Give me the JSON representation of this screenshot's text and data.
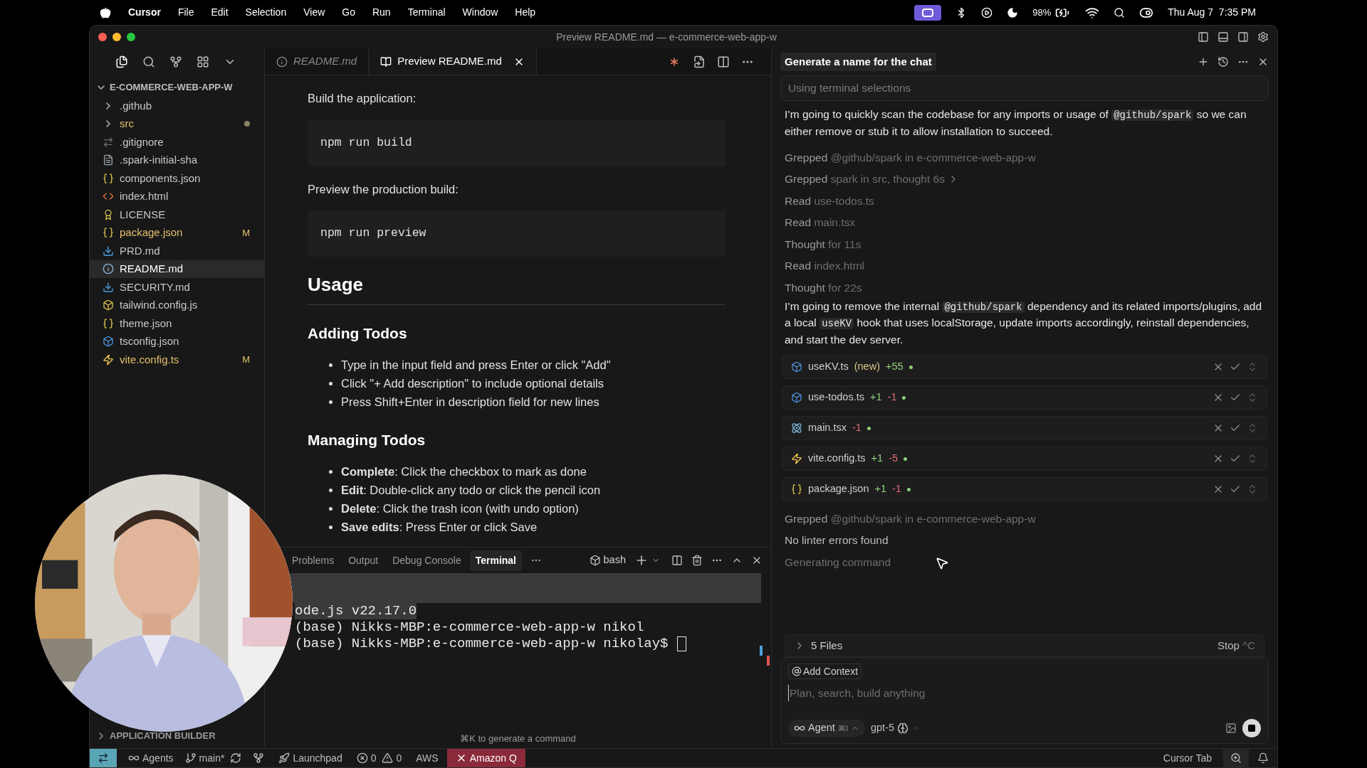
{
  "menubar": {
    "app": "Cursor",
    "items": [
      "File",
      "Edit",
      "Selection",
      "View",
      "Go",
      "Run",
      "Terminal",
      "Window",
      "Help"
    ],
    "battery": "98%",
    "clock": "Thu Aug 7  7:35 PM"
  },
  "window": {
    "title": "Preview README.md — e-commerce-web-app-w"
  },
  "explorer": {
    "root": "E-COMMERCE-WEB-APP-W",
    "expanded": true,
    "items": [
      {
        "name": ".github",
        "kind": "folder",
        "modified": false,
        "selected": false
      },
      {
        "name": "src",
        "kind": "folder",
        "modified": true,
        "dot": true,
        "selected": false
      },
      {
        "name": ".gitignore",
        "kind": "git",
        "modified": false,
        "selected": false
      },
      {
        "name": ".spark-initial-sha",
        "kind": "text",
        "modified": false,
        "selected": false
      },
      {
        "name": "components.json",
        "kind": "json",
        "modified": false,
        "selected": false
      },
      {
        "name": "index.html",
        "kind": "html",
        "modified": false,
        "selected": false
      },
      {
        "name": "LICENSE",
        "kind": "license",
        "modified": false,
        "selected": false
      },
      {
        "name": "package.json",
        "kind": "json",
        "modified": true,
        "badge": "M",
        "selected": false
      },
      {
        "name": "PRD.md",
        "kind": "md",
        "modified": false,
        "selected": false
      },
      {
        "name": "README.md",
        "kind": "info",
        "modified": false,
        "selected": true
      },
      {
        "name": "SECURITY.md",
        "kind": "md",
        "modified": false,
        "selected": false
      },
      {
        "name": "tailwind.config.js",
        "kind": "js",
        "modified": false,
        "selected": false
      },
      {
        "name": "theme.json",
        "kind": "json",
        "modified": false,
        "selected": false
      },
      {
        "name": "tsconfig.json",
        "kind": "ts",
        "modified": false,
        "selected": false
      },
      {
        "name": "vite.config.ts",
        "kind": "vite",
        "modified": true,
        "badge": "M",
        "selected": false
      }
    ],
    "sections": [
      "APPLICATION BUILDER"
    ]
  },
  "editor": {
    "tabs": [
      {
        "label": "README.md",
        "selected": false,
        "italic": true
      },
      {
        "label": "Preview README.md",
        "selected": true,
        "italic": false
      }
    ],
    "blocks": [
      {
        "kind": "p",
        "text": "Build the application:"
      },
      {
        "kind": "code",
        "text": "npm run build"
      },
      {
        "kind": "p",
        "text": "Preview the production build:"
      },
      {
        "kind": "code",
        "text": "npm run preview"
      },
      {
        "kind": "h1",
        "text": "Usage"
      },
      {
        "kind": "h2",
        "text": "Adding Todos"
      },
      {
        "kind": "list",
        "items": [
          "Type in the input field and press Enter or click \"Add\"",
          "Click \"+ Add description\" to include optional details",
          "Press Shift+Enter in description field for new lines"
        ]
      },
      {
        "kind": "h2",
        "text": "Managing Todos"
      },
      {
        "kind": "list",
        "items": [
          "**Complete**: Click the checkbox to mark as done",
          "**Edit**: Double-click any todo or click the pencil icon",
          "**Delete**: Click the trash icon (with undo option)",
          "**Save edits**: Press Enter or click Save"
        ]
      }
    ]
  },
  "terminal": {
    "tabs": [
      {
        "label": "Problems",
        "selected": false
      },
      {
        "label": "Output",
        "selected": false
      },
      {
        "label": "Debug Console",
        "selected": false
      },
      {
        "label": "Terminal",
        "selected": true
      }
    ],
    "shell": "bash",
    "lines": [
      "ode.js v22.17.0",
      "(base) Nikks-MBP:e-commerce-web-app-w nikol",
      "(base) Nikks-MBP:e-commerce-web-app-w nikolay$"
    ],
    "hint": "⌘K to generate a command"
  },
  "chat": {
    "title": "Generate a name for the chat",
    "context": "Using terminal selections",
    "entries": [
      {
        "kind": "message",
        "parts": [
          {
            "text": "I’m going to quickly scan the codebase for any imports or usage of ",
            "code": false
          },
          {
            "text": "@github/spark",
            "code": true
          },
          {
            "text": " so we can either remove or stub it to allow installation to succeed.",
            "code": false
          }
        ]
      },
      {
        "kind": "step",
        "verb": "Grepped",
        "detail": "@github/spark in e-commerce-web-app-w",
        "expandable": false
      },
      {
        "kind": "step",
        "verb": "Grepped",
        "detail": "spark in src, thought 6s",
        "expandable": true
      },
      {
        "kind": "step",
        "verb": "Read",
        "detail": "use-todos.ts",
        "expandable": false
      },
      {
        "kind": "step",
        "verb": "Read",
        "detail": "main.tsx",
        "expandable": false
      },
      {
        "kind": "step",
        "verb": "Thought",
        "detail": "for 11s",
        "expandable": false
      },
      {
        "kind": "step",
        "verb": "Read",
        "detail": "index.html",
        "expandable": false
      },
      {
        "kind": "step",
        "verb": "Thought",
        "detail": "for 22s",
        "expandable": false
      },
      {
        "kind": "message",
        "parts": [
          {
            "text": "I’m going to remove the internal ",
            "code": false
          },
          {
            "text": "@github/spark",
            "code": true
          },
          {
            "text": " dependency and its related imports/plugins, add a local ",
            "code": false
          },
          {
            "text": "useKV",
            "code": true
          },
          {
            "text": " hook that uses localStorage, update imports accordingly, reinstall dependencies, and start the dev server.",
            "code": false
          }
        ]
      },
      {
        "kind": "file",
        "name": "useKV.ts",
        "tag": "(new)",
        "added": "+55"
      },
      {
        "kind": "file",
        "name": "use-todos.ts",
        "added": "+1",
        "removed": "-1"
      },
      {
        "kind": "file",
        "name": "main.tsx",
        "removed": "-1"
      },
      {
        "kind": "file",
        "name": "vite.config.ts",
        "added": "+1",
        "removed": "-5"
      },
      {
        "kind": "file",
        "name": "package.json",
        "added": "+1",
        "removed": "-1"
      },
      {
        "kind": "step",
        "verb": "Grepped",
        "detail": "@github/spark in e-commerce-web-app-w",
        "expandable": false
      },
      {
        "kind": "status",
        "text": "No linter errors found"
      },
      {
        "kind": "pending",
        "text": "Generating command"
      }
    ],
    "files_bar": {
      "label": "5 Files",
      "stop": "Stop",
      "shortcut": "^C"
    },
    "composer": {
      "add_context": "Add Context",
      "placeholder": "Plan, search, build anything",
      "mode": "Agent",
      "mode_shortcut": "⌘I",
      "model": "gpt-5"
    }
  },
  "status_bar": {
    "agents": "Agents",
    "branch": "main*",
    "launchpad": "Launchpad",
    "errors": "0",
    "warnings": "0",
    "aws": "AWS",
    "amazon_q": "Amazon Q",
    "cursor_tab": "Cursor Tab"
  }
}
